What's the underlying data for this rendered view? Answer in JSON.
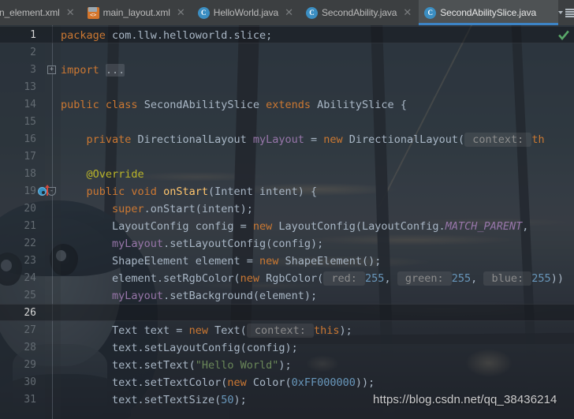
{
  "tabs": [
    {
      "label": "n_element.xml",
      "icon": "xml-file-icon",
      "active": false,
      "truncated": true
    },
    {
      "label": "main_layout.xml",
      "icon": "xml-layout-icon",
      "active": false
    },
    {
      "label": "HelloWorld.java",
      "icon": "java-class-icon",
      "active": false
    },
    {
      "label": "SecondAbility.java",
      "icon": "java-class-icon",
      "active": false
    },
    {
      "label": "SecondAbilitySlice.java",
      "icon": "java-class-icon",
      "active": true
    }
  ],
  "tab_tools": {
    "sort_dropdown_icon": "chevron-down-icon",
    "list_icon": "tab-list-icon"
  },
  "editor": {
    "file": "SecondAbilitySlice.java",
    "language": "java",
    "caret_lines": [
      1,
      26
    ],
    "inspection_status_icon": "green-check-icon",
    "inspection_status_color": "#59a869",
    "gutter": {
      "fold_expand_icon": "+",
      "fold_collapse_icon": "-",
      "override_marker_line": 19,
      "override_marker_icon": "overriding-method-icon"
    },
    "lines": [
      {
        "num": "1",
        "indent": 0,
        "tokens": [
          {
            "t": "package ",
            "c": "kw"
          },
          {
            "t": "com.llw.helloworld.slice;",
            "c": "plain"
          }
        ]
      },
      {
        "num": "2",
        "indent": 0,
        "tokens": []
      },
      {
        "num": "3",
        "indent": 0,
        "fold": "expand",
        "tokens": [
          {
            "t": "import ",
            "c": "kw"
          },
          {
            "t": "...",
            "c": "fold-ph"
          }
        ]
      },
      {
        "num": "13",
        "indent": 0,
        "tokens": []
      },
      {
        "num": "14",
        "indent": 0,
        "tokens": [
          {
            "t": "public ",
            "c": "kw"
          },
          {
            "t": "class ",
            "c": "kw"
          },
          {
            "t": "SecondAbilitySlice ",
            "c": "plain"
          },
          {
            "t": "extends ",
            "c": "kw"
          },
          {
            "t": "AbilitySlice {",
            "c": "plain"
          }
        ]
      },
      {
        "num": "15",
        "indent": 0,
        "tokens": []
      },
      {
        "num": "16",
        "indent": 1,
        "tokens": [
          {
            "t": "private ",
            "c": "kw"
          },
          {
            "t": "DirectionalLayout ",
            "c": "plain"
          },
          {
            "t": "myLayout",
            "c": "fld"
          },
          {
            "t": " = ",
            "c": "plain"
          },
          {
            "t": "new ",
            "c": "kw"
          },
          {
            "t": "DirectionalLayout(",
            "c": "plain"
          },
          {
            "t": " context: ",
            "c": "hint"
          },
          {
            "t": "th",
            "c": "kw"
          }
        ]
      },
      {
        "num": "17",
        "indent": 0,
        "tokens": []
      },
      {
        "num": "18",
        "indent": 1,
        "tokens": [
          {
            "t": "@Override",
            "c": "anno"
          }
        ]
      },
      {
        "num": "19",
        "indent": 1,
        "fold": "collapse",
        "marker": "override",
        "tokens": [
          {
            "t": "public ",
            "c": "kw"
          },
          {
            "t": "void ",
            "c": "kw"
          },
          {
            "t": "onStart",
            "c": "mth"
          },
          {
            "t": "(Intent intent) {",
            "c": "plain"
          }
        ]
      },
      {
        "num": "20",
        "indent": 2,
        "tokens": [
          {
            "t": "super",
            "c": "kw"
          },
          {
            "t": ".onStart(intent);",
            "c": "plain"
          }
        ]
      },
      {
        "num": "21",
        "indent": 2,
        "tokens": [
          {
            "t": "LayoutConfig config = ",
            "c": "plain"
          },
          {
            "t": "new ",
            "c": "kw"
          },
          {
            "t": "LayoutConfig(LayoutConfig.",
            "c": "plain"
          },
          {
            "t": "MATCH_PARENT",
            "c": "stat"
          },
          {
            "t": ",",
            "c": "plain"
          }
        ]
      },
      {
        "num": "22",
        "indent": 2,
        "tokens": [
          {
            "t": "myLayout",
            "c": "fld"
          },
          {
            "t": ".setLayoutConfig(config);",
            "c": "plain"
          }
        ]
      },
      {
        "num": "23",
        "indent": 2,
        "tokens": [
          {
            "t": "ShapeElement element = ",
            "c": "plain"
          },
          {
            "t": "new ",
            "c": "kw"
          },
          {
            "t": "ShapeElement();",
            "c": "plain"
          }
        ]
      },
      {
        "num": "24",
        "indent": 2,
        "tokens": [
          {
            "t": "element.setRgbColor(",
            "c": "plain"
          },
          {
            "t": "new ",
            "c": "kw"
          },
          {
            "t": "RgbColor(",
            "c": "plain"
          },
          {
            "t": " red: ",
            "c": "hint"
          },
          {
            "t": "255",
            "c": "num"
          },
          {
            "t": ", ",
            "c": "plain"
          },
          {
            "t": " green: ",
            "c": "hint"
          },
          {
            "t": "255",
            "c": "num"
          },
          {
            "t": ", ",
            "c": "plain"
          },
          {
            "t": " blue: ",
            "c": "hint"
          },
          {
            "t": "255",
            "c": "num"
          },
          {
            "t": "))",
            "c": "plain"
          }
        ]
      },
      {
        "num": "25",
        "indent": 2,
        "tokens": [
          {
            "t": "myLayout",
            "c": "fld"
          },
          {
            "t": ".setBackground(element);",
            "c": "plain"
          }
        ]
      },
      {
        "num": "26",
        "indent": 0,
        "tokens": []
      },
      {
        "num": "27",
        "indent": 2,
        "tokens": [
          {
            "t": "Text text = ",
            "c": "plain"
          },
          {
            "t": "new ",
            "c": "kw"
          },
          {
            "t": "Text(",
            "c": "plain"
          },
          {
            "t": " context: ",
            "c": "hint"
          },
          {
            "t": "this",
            "c": "kw"
          },
          {
            "t": ");",
            "c": "plain"
          }
        ]
      },
      {
        "num": "28",
        "indent": 2,
        "tokens": [
          {
            "t": "text.setLayoutConfig(config);",
            "c": "plain"
          }
        ]
      },
      {
        "num": "29",
        "indent": 2,
        "tokens": [
          {
            "t": "text.setText(",
            "c": "plain"
          },
          {
            "t": "\"Hello World\"",
            "c": "str"
          },
          {
            "t": ");",
            "c": "plain"
          }
        ]
      },
      {
        "num": "30",
        "indent": 2,
        "tokens": [
          {
            "t": "text.setTextColor(",
            "c": "plain"
          },
          {
            "t": "new ",
            "c": "kw"
          },
          {
            "t": "Color(",
            "c": "plain"
          },
          {
            "t": "0xFF000000",
            "c": "num"
          },
          {
            "t": "));",
            "c": "plain"
          }
        ]
      },
      {
        "num": "31",
        "indent": 2,
        "tokens": [
          {
            "t": "text.setTextSize(",
            "c": "plain"
          },
          {
            "t": "50",
            "c": "num"
          },
          {
            "t": ");",
            "c": "plain"
          }
        ]
      }
    ]
  },
  "watermark": {
    "text": "https://blog.csdn.net/qq_38436214"
  },
  "colors": {
    "tab_active_bg": "#4e5254",
    "tab_active_underline": "#3d84c6",
    "tabbar_bg": "#3c3f41",
    "keyword": "#cc7832",
    "string": "#6a8759",
    "number": "#6897bb",
    "field": "#9876aa",
    "method": "#ffc66d",
    "annotation": "#bbb529",
    "default_text": "#a9b7c6",
    "param_hint": "#8c8c8c",
    "line_number": "#636b72"
  }
}
